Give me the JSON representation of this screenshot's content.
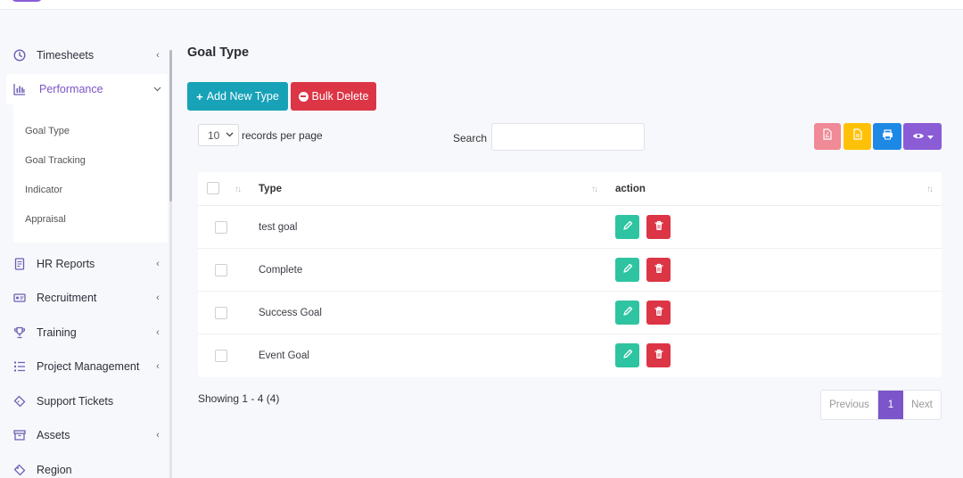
{
  "sidebar": {
    "items": [
      {
        "label": "Timesheets",
        "icon": "clock-icon"
      },
      {
        "label": "Performance",
        "icon": "bar-chart-icon"
      },
      {
        "label": "HR Reports",
        "icon": "report-icon"
      },
      {
        "label": "Recruitment",
        "icon": "id-card-icon"
      },
      {
        "label": "Training",
        "icon": "trophy-icon"
      },
      {
        "label": "Project Management",
        "icon": "list-icon"
      },
      {
        "label": "Support Tickets",
        "icon": "ticket-icon"
      },
      {
        "label": "Assets",
        "icon": "archive-icon"
      },
      {
        "label": "Region",
        "icon": "tag-icon"
      }
    ],
    "submenu": [
      "Goal Type",
      "Goal Tracking",
      "Indicator",
      "Appraisal"
    ]
  },
  "page": {
    "title": "Goal Type"
  },
  "toolbar": {
    "add_label": "Add New Type",
    "bulk_delete_label": "Bulk Delete",
    "length_value": "10",
    "length_label": "records per page",
    "search_label": "Search",
    "search_value": ""
  },
  "colors": {
    "accent": "#7b55c9",
    "add": "#17a2b8",
    "delete": "#dc3545",
    "edit": "#2ec4a1",
    "pdf": "#f08a96",
    "csv": "#ffc107",
    "print": "#1e88e5",
    "columns": "#8a5cd6"
  },
  "table": {
    "columns": [
      "Type",
      "action"
    ],
    "rows": [
      {
        "type": "test goal"
      },
      {
        "type": "Complete"
      },
      {
        "type": "Success Goal"
      },
      {
        "type": "Event Goal"
      }
    ]
  },
  "footer": {
    "info": "Showing 1 - 4 (4)",
    "prev": "Previous",
    "current_page": "1",
    "next": "Next"
  }
}
